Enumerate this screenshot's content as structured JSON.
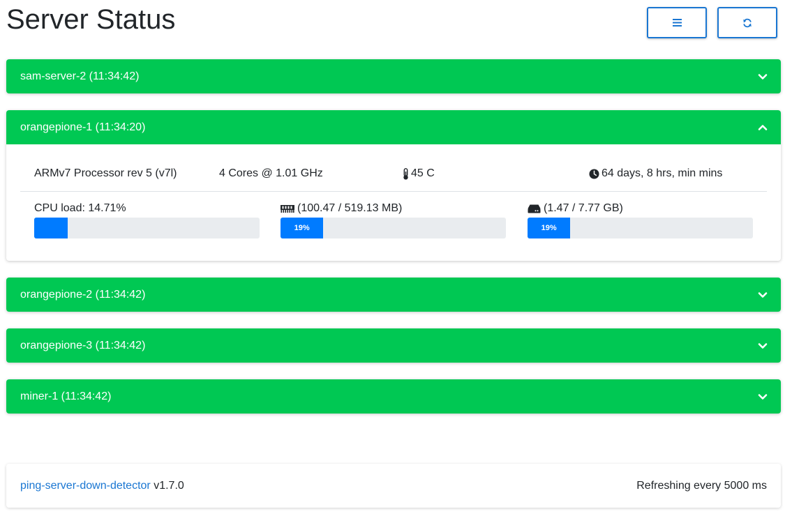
{
  "page": {
    "title": "Server Status"
  },
  "header": {
    "menu_icon": "bars-icon",
    "refresh_icon": "sync-icon"
  },
  "colors": {
    "panel_header": "#00c853",
    "accent": "#1976d2",
    "progress": "#007bff"
  },
  "servers": [
    {
      "title": "sam-server-2 (11:34:42)",
      "expanded": false
    },
    {
      "title": "orangepione-1 (11:34:20)",
      "expanded": true,
      "processor": "ARMv7 Processor rev 5 (v7l)",
      "cores": "4 Cores @ 1.01 GHz",
      "temperature": "45 C",
      "uptime": "64 days, 8 hrs, min mins",
      "cpu_label": "CPU load: 14.71%",
      "cpu_fraction": 0.1471,
      "memory_label": "(100.47 / 519.13 MB)",
      "memory_percent_label": "19%",
      "memory_fraction": 0.19,
      "disk_label": "(1.47 / 7.77 GB)",
      "disk_percent_label": "19%",
      "disk_fraction": 0.19
    },
    {
      "title": "orangepione-2 (11:34:42)",
      "expanded": false
    },
    {
      "title": "orangepione-3 (11:34:42)",
      "expanded": false
    },
    {
      "title": "miner-1 (11:34:42)",
      "expanded": false
    }
  ],
  "footer": {
    "project_link": "ping-server-down-detector",
    "version": " v1.7.0",
    "refresh_text": "Refreshing every 5000 ms"
  }
}
